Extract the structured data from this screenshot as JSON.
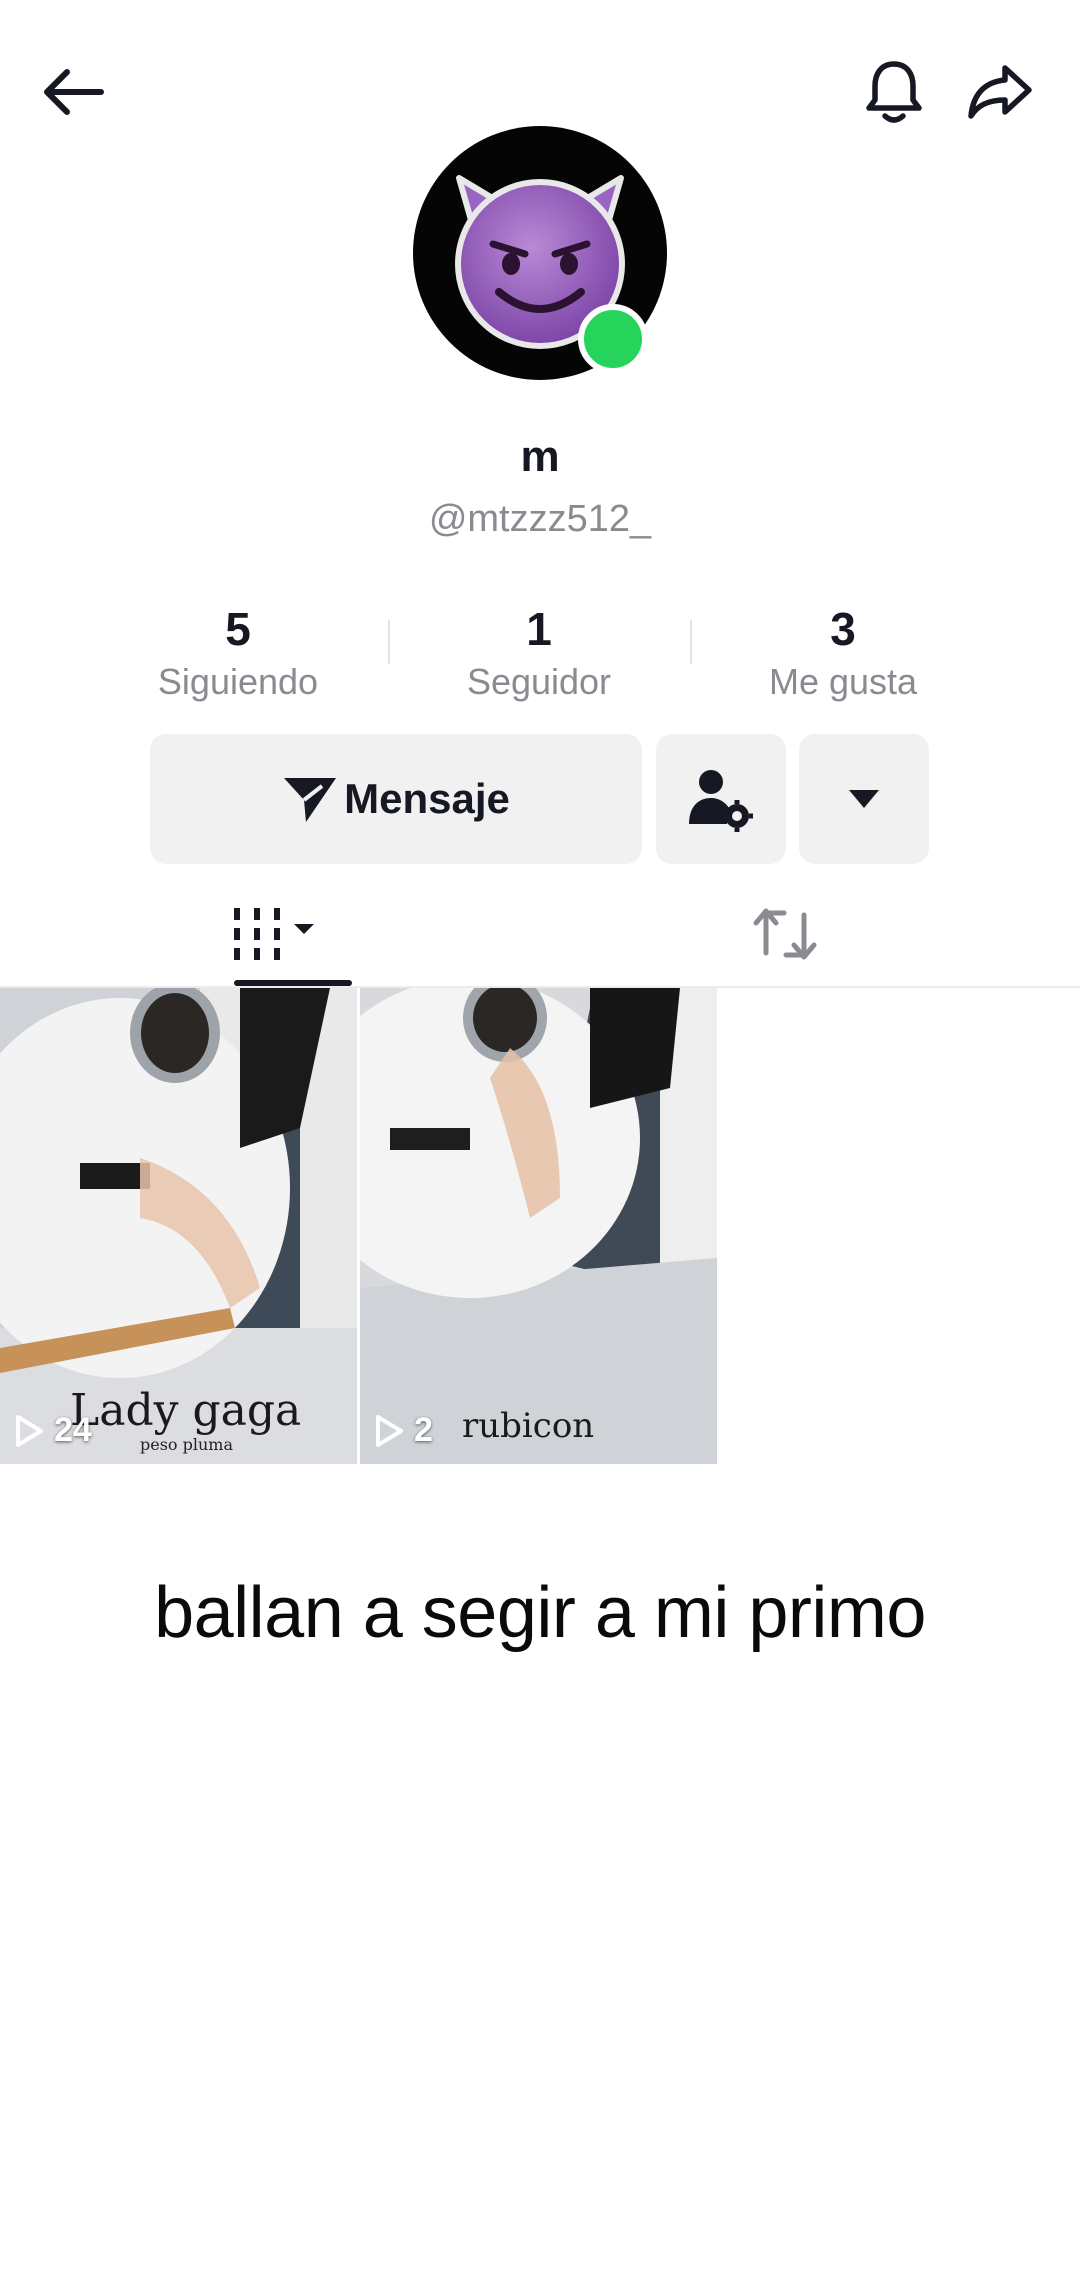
{
  "header": {
    "back_icon": "arrow-left-icon",
    "notify_icon": "bell-icon",
    "share_icon": "share-arrow-icon"
  },
  "profile": {
    "avatar_icon": "smiling-devil-emoji",
    "online": true,
    "online_color": "#26d35b",
    "display_name": "m",
    "handle": "@mtzzz512_"
  },
  "stats": [
    {
      "value": "5",
      "label": "Siguiendo"
    },
    {
      "value": "1",
      "label": "Seguidor"
    },
    {
      "value": "3",
      "label": "Me gusta"
    }
  ],
  "actions": {
    "message_label": "Mensaje",
    "message_icon": "send-plane-icon",
    "friends_icon": "user-settings-icon",
    "more_icon": "caret-down-icon"
  },
  "tabs": [
    {
      "name": "videos",
      "icon": "grid-bars-icon",
      "active": true
    },
    {
      "name": "reposts",
      "icon": "repost-icon",
      "active": false
    }
  ],
  "videos": [
    {
      "views": "24",
      "caption": "Lady gaga",
      "sub_caption": "peso pluma"
    },
    {
      "views": "2",
      "caption": "rubicon"
    }
  ],
  "overlay_text": "ballan a segir a mi primo"
}
